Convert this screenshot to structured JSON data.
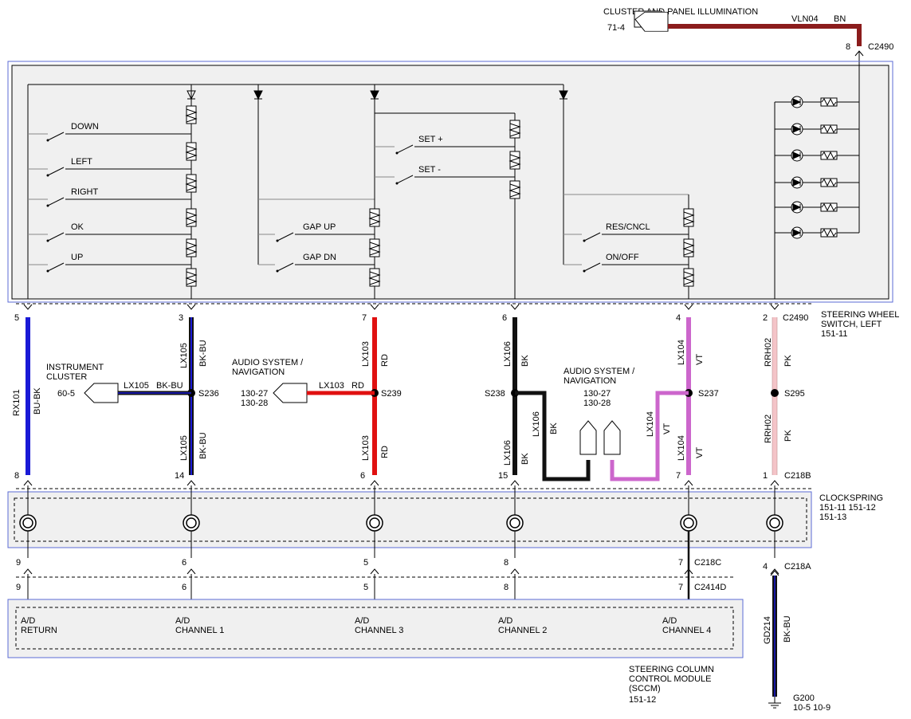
{
  "colors": {
    "blue": "#1a1ad6",
    "black": "#111111",
    "red": "#e01010",
    "violet": "#cc66cc",
    "pink": "#f4c4c8",
    "brown": "#8b1c1c",
    "box_fill": "#f0f0f0",
    "box_border": "#5b6bd6"
  },
  "illumination": {
    "title": "CLUSTER AND PANEL ILLUMINATION",
    "ref": "71-4",
    "circuit": "VLN04",
    "color": "BN",
    "pin": "8",
    "connector": "C2490"
  },
  "switch_labels": [
    "DOWN",
    "LEFT",
    "RIGHT",
    "OK",
    "UP",
    "SET +",
    "SET -",
    "GAP UP",
    "GAP DN",
    "RES/CNCL",
    "ON/OFF"
  ],
  "steering_switch": {
    "line1": "STEERING WHEEL",
    "line2": "SWITCH, LEFT",
    "ref": "151-11",
    "connector": "C2490"
  },
  "clockspring": {
    "name": "CLOCKSPRING",
    "ref1": "151-11   151-12",
    "ref2": "151-13"
  },
  "wires": [
    {
      "top_pin": "5",
      "circuit": "RX101",
      "color": "BU-BK",
      "bottom_pin": "8"
    },
    {
      "top_pin": "3",
      "circuit": "LX105",
      "color": "BK-BU",
      "splice": "S236",
      "circuit2": "LX105",
      "color2": "BK-BU",
      "bottom_pin": "14"
    },
    {
      "top_pin": "7",
      "circuit": "LX103",
      "color": "RD",
      "splice": "S239",
      "circuit2": "LX103",
      "color2": "RD",
      "bottom_pin": "6"
    },
    {
      "top_pin": "6",
      "circuit": "LX106",
      "color": "BK",
      "splice": "S238",
      "circuit2": "LX106",
      "color2": "BK",
      "bottom_pin": "15"
    },
    {
      "top_pin": "4",
      "circuit": "LX104",
      "color": "VT",
      "splice": "S237",
      "circuit2": "LX104",
      "color2": "VT",
      "bottom_pin": "7"
    },
    {
      "top_pin": "2",
      "circuit": "RRH02",
      "color": "PK",
      "splice": "S295",
      "circuit2": "RRH02",
      "color2": "PK",
      "bottom_pin": "1"
    }
  ],
  "instrument_cluster": {
    "line1": "INSTRUMENT",
    "line2": "CLUSTER",
    "ref": "60-5",
    "circuit": "LX105",
    "color": "BK-BU"
  },
  "audio_left": {
    "line1": "AUDIO SYSTEM /",
    "line2": "NAVIGATION",
    "ref1": "130-27",
    "ref2": "130-28",
    "circuit": "LX103",
    "color": "RD"
  },
  "audio_right": {
    "line1": "AUDIO SYSTEM /",
    "line2": "NAVIGATION",
    "ref1": "130-27",
    "ref2": "130-28",
    "circuit_a": "LX106",
    "color_a": "BK",
    "circuit_b": "LX104",
    "color_b": "VT"
  },
  "c218b": "C218B",
  "c218c": "C218C",
  "c218a": "C218A",
  "c2414d": "C2414D",
  "lower_pins": [
    "9",
    "6",
    "5",
    "8",
    "7"
  ],
  "sccm_inputs": [
    {
      "line1": "A/D",
      "line2": "RETURN"
    },
    {
      "line1": "A/D",
      "line2": "CHANNEL 1"
    },
    {
      "line1": "A/D",
      "line2": "CHANNEL 3"
    },
    {
      "line1": "A/D",
      "line2": "CHANNEL 2"
    },
    {
      "line1": "A/D",
      "line2": "CHANNEL 4"
    }
  ],
  "sccm": {
    "line1": "STEERING COLUMN",
    "line2": "CONTROL MODULE",
    "line3": "(SCCM)",
    "ref": "151-12"
  },
  "ground": {
    "pin": "4",
    "circuit": "GD214",
    "color": "BK-BU",
    "name": "G200",
    "ref": "10-5   10-9"
  }
}
